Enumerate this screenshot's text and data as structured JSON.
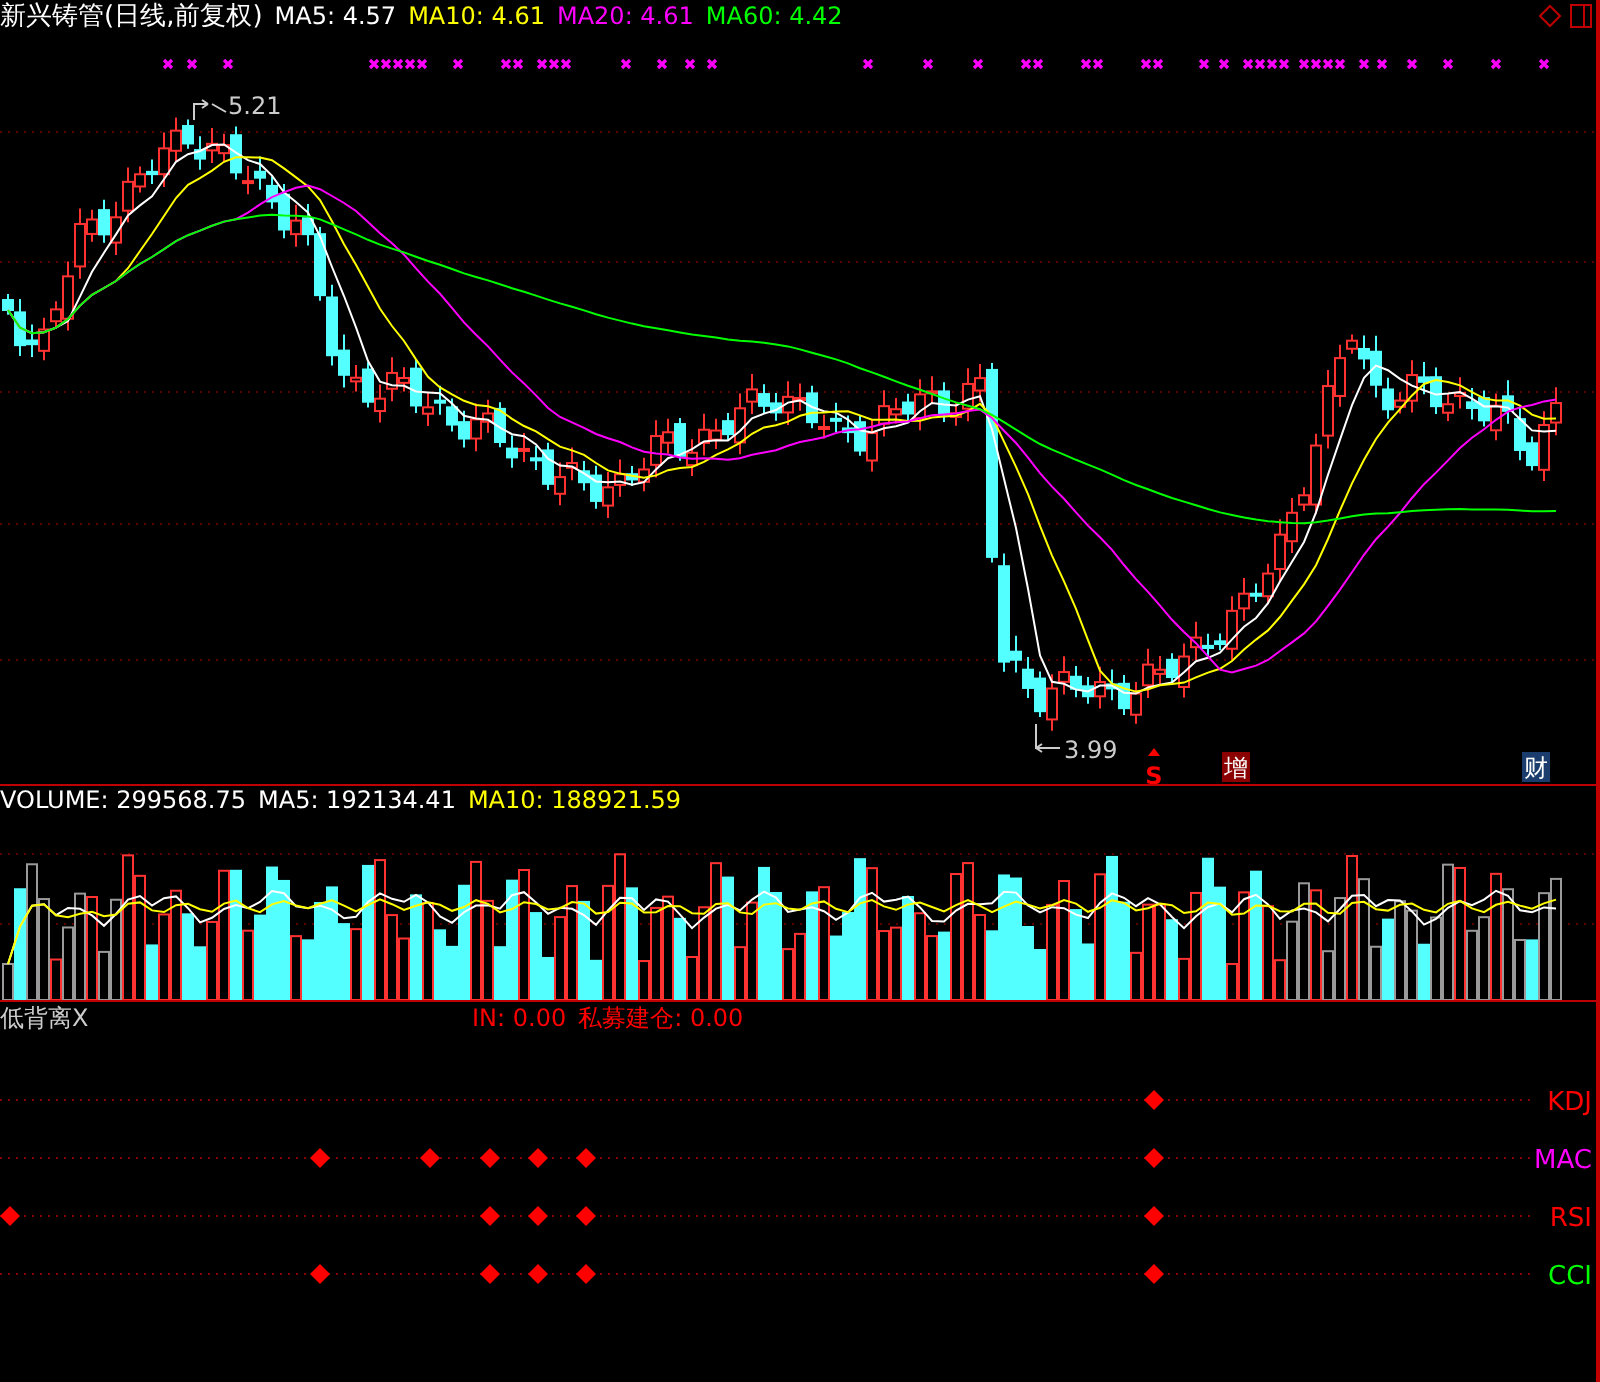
{
  "main": {
    "title": "新兴铸管(日线,前复权)",
    "legend": [
      {
        "label": "MA5: 4.57",
        "color": "#ffffff"
      },
      {
        "label": "MA10: 4.61",
        "color": "#ffff00"
      },
      {
        "label": "MA20: 4.61",
        "color": "#ff00ff"
      },
      {
        "label": "MA60: 4.42",
        "color": "#00ff00"
      }
    ],
    "high_label": "5.21",
    "low_label": "3.99",
    "events": [
      {
        "kind": "arrow",
        "label": "S",
        "color": "#ff0000"
      },
      {
        "kind": "box",
        "label": "增",
        "color": "#8b0000"
      },
      {
        "kind": "box",
        "label": "财",
        "color": "#1a3d6e"
      }
    ]
  },
  "volume": {
    "legend": [
      {
        "label": "VOLUME: 299568.75",
        "color": "#ffffff"
      },
      {
        "label": "MA5: 192134.41",
        "color": "#ffffff"
      },
      {
        "label": "MA10: 188921.59",
        "color": "#ffff00"
      }
    ]
  },
  "indicator": {
    "name": "低背离X",
    "readings": [
      {
        "label": "IN: 0.00",
        "color": "#ff0000"
      },
      {
        "label": "私募建仓: 0.00",
        "color": "#ff0000"
      }
    ],
    "signals": [
      {
        "label": "KDJ",
        "color": "#ff0000"
      },
      {
        "label": "MAC",
        "color": "#ff00ff"
      },
      {
        "label": "RSI",
        "color": "#ff0000"
      },
      {
        "label": "CCI",
        "color": "#00ff00"
      }
    ]
  }
}
